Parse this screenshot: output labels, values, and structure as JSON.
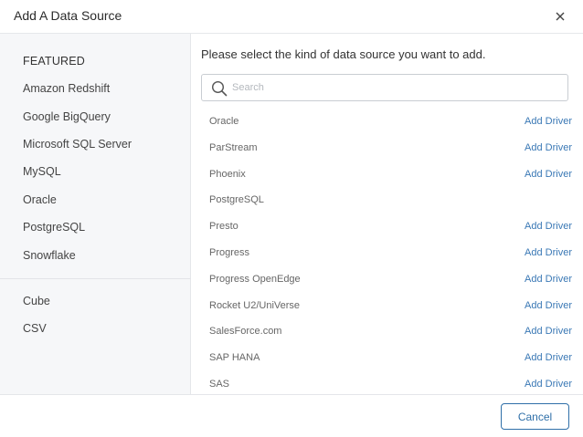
{
  "dialog": {
    "title": "Add A Data Source"
  },
  "sidebar": {
    "featured_heading": "FEATURED",
    "featured_items": [
      {
        "label": "Amazon Redshift"
      },
      {
        "label": "Google BigQuery"
      },
      {
        "label": "Microsoft SQL Server"
      },
      {
        "label": "MySQL"
      },
      {
        "label": "Oracle"
      },
      {
        "label": "PostgreSQL"
      },
      {
        "label": "Snowflake"
      }
    ],
    "other_items": [
      {
        "label": "Cube"
      },
      {
        "label": "CSV"
      }
    ]
  },
  "main": {
    "prompt": "Please select the kind of data source you want to add.",
    "search": {
      "placeholder": "Search",
      "value": ""
    },
    "sources": [
      {
        "name": "Oracle",
        "action": "Add Driver"
      },
      {
        "name": "ParStream",
        "action": "Add Driver"
      },
      {
        "name": "Phoenix",
        "action": "Add Driver"
      },
      {
        "name": "PostgreSQL",
        "action": ""
      },
      {
        "name": "Presto",
        "action": "Add Driver"
      },
      {
        "name": "Progress",
        "action": "Add Driver"
      },
      {
        "name": "Progress OpenEdge",
        "action": "Add Driver"
      },
      {
        "name": "Rocket U2/UniVerse",
        "action": "Add Driver"
      },
      {
        "name": "SalesForce.com",
        "action": "Add Driver"
      },
      {
        "name": "SAP HANA",
        "action": "Add Driver"
      },
      {
        "name": "SAS",
        "action": "Add Driver"
      }
    ]
  },
  "footer": {
    "cancel_label": "Cancel"
  },
  "icons": {
    "close": "close-icon",
    "search": "search-icon"
  },
  "colors": {
    "link": "#3a78b5",
    "button_border": "#2f6fa8",
    "sidebar_bg": "#f6f7f9"
  }
}
